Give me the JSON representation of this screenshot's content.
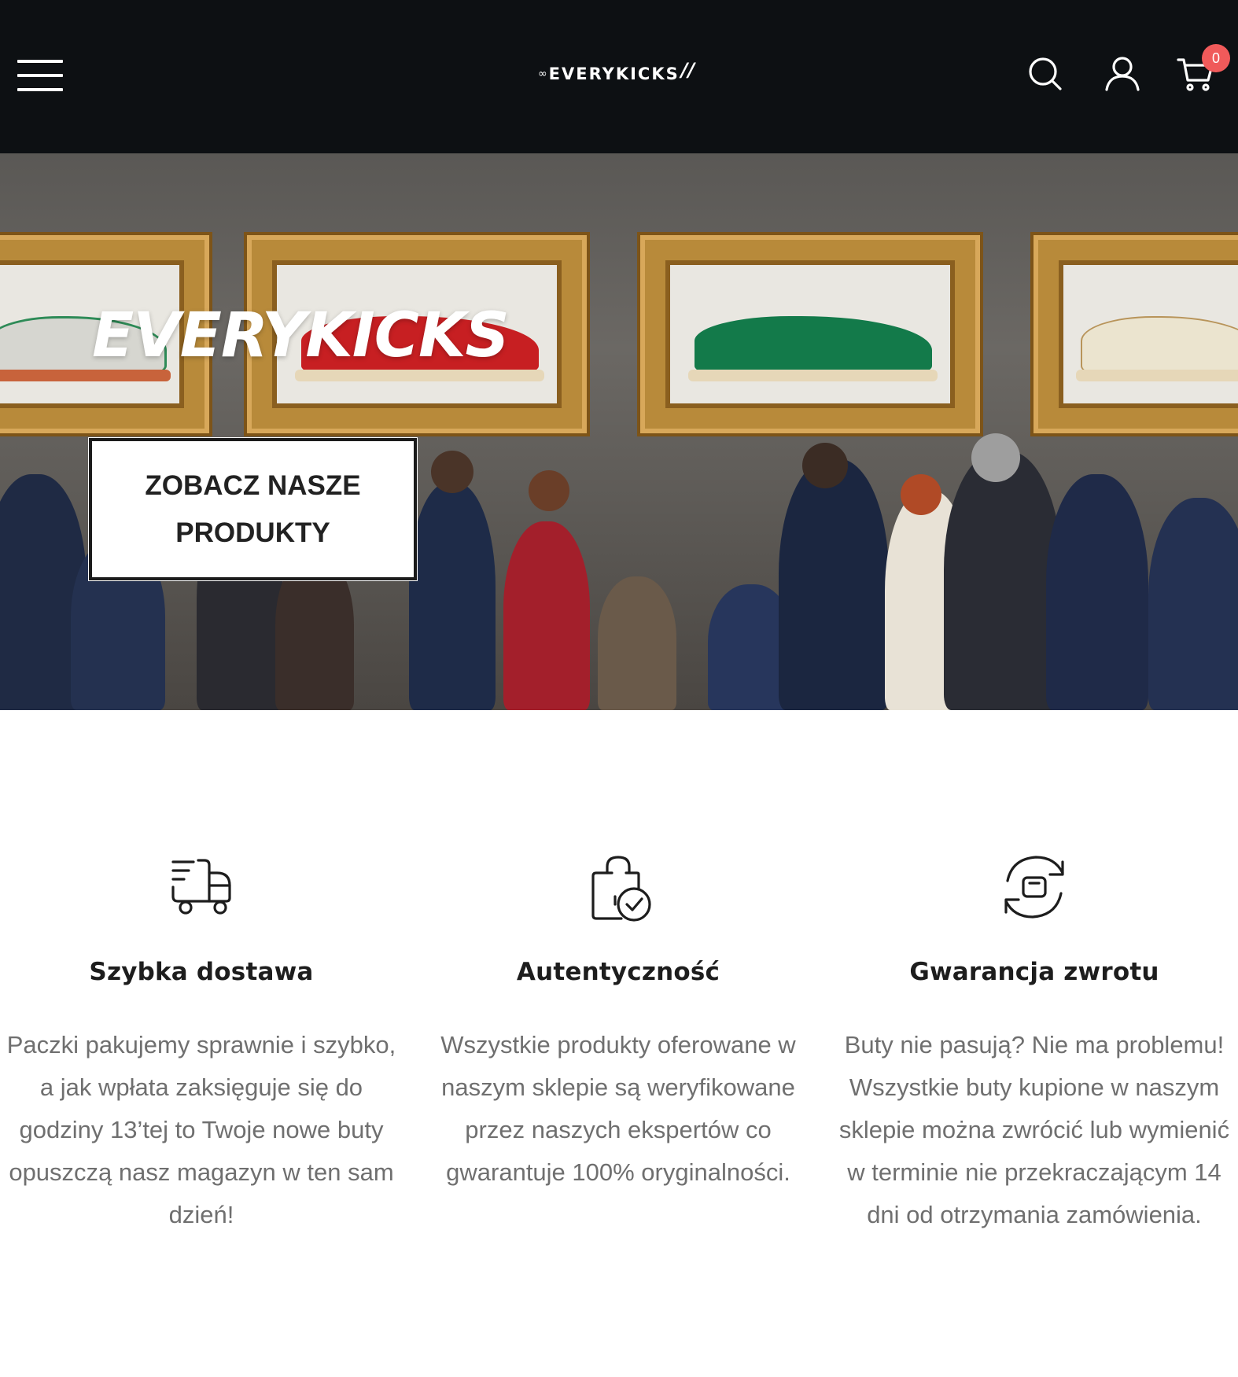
{
  "header": {
    "logo": {
      "infinity": "∞",
      "text": "EVERYKICKS",
      "marks": "//"
    },
    "cart_count": "0",
    "icons": {
      "menu": "hamburger-menu-icon",
      "search": "search-icon",
      "account": "user-icon",
      "cart": "cart-icon"
    }
  },
  "hero": {
    "title": "EVERYKICKS",
    "cta_label": "ZOBACZ NASZE PRODUKTY"
  },
  "features": [
    {
      "icon": "delivery-truck-icon",
      "title": "Szybka dostawa",
      "text": "Paczki pakujemy sprawnie i szybko, a jak wpłata zaksięguje się do godziny 13’tej to Twoje nowe buty opuszczą nasz magazyn w ten sam dzień!"
    },
    {
      "icon": "verified-bag-icon",
      "title": "Autentyczność",
      "text": "Wszystkie produkty oferowane w naszym sklepie są weryfikowane przez naszych ekspertów co gwarantuje 100% oryginalności."
    },
    {
      "icon": "return-exchange-icon",
      "title": "Gwarancja zwrotu",
      "text": "Buty nie pasują? Nie ma problemu! Wszystkie buty kupione w naszym sklepie można zwrócić lub wymienić w terminie nie przekraczającym 14 dni od otrzymania zamówienia."
    }
  ],
  "colors": {
    "header_bg": "#0d1013",
    "badge": "#f05a5a",
    "body_text": "#6f6f6f",
    "heading_text": "#1d1d1d"
  }
}
